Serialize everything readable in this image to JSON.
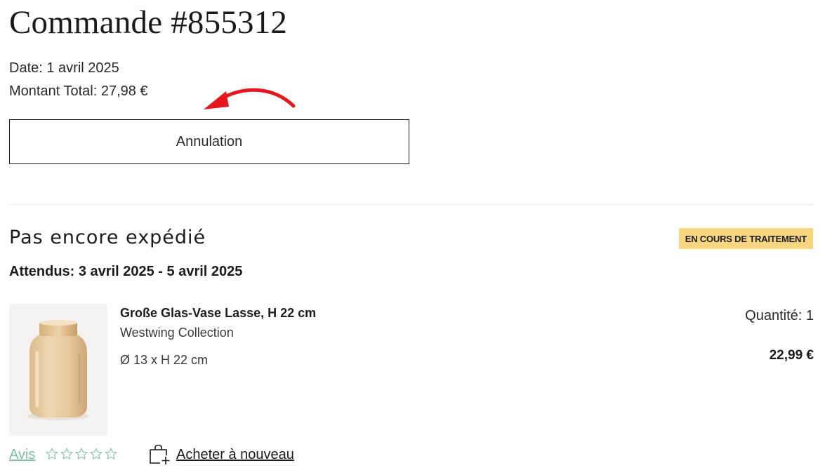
{
  "order": {
    "title": "Commande #855312",
    "date": "Date: 1 avril 2025",
    "total": "Montant Total: 27,98 €",
    "cancel_label": "Annulation"
  },
  "shipment": {
    "title": "Pas encore expédié",
    "status_badge": "EN COURS DE TRAITEMENT",
    "expected": "Attendus: 3 avril 2025 - 5 avril 2025"
  },
  "product": {
    "name": "Große Glas-Vase Lasse, H 22 cm",
    "brand": "Westwing Collection",
    "dimensions": "Ø 13 x H 22 cm",
    "quantity": "Quantité: 1",
    "price": "22,99 €",
    "image_icon": "vase-image"
  },
  "actions": {
    "review_label": "Avis",
    "rating": 0,
    "rating_max": 5,
    "buy_again_label": "Acheter à nouveau",
    "buy_again_icon": "bag-plus-icon"
  },
  "annotation": {
    "arrow_icon": "red-arrow-icon",
    "arrow_color": "#e5171d"
  },
  "colors": {
    "badge_bg": "#f8d57f",
    "review_link": "#7cbfa6",
    "divider": "#e6e6e6"
  }
}
